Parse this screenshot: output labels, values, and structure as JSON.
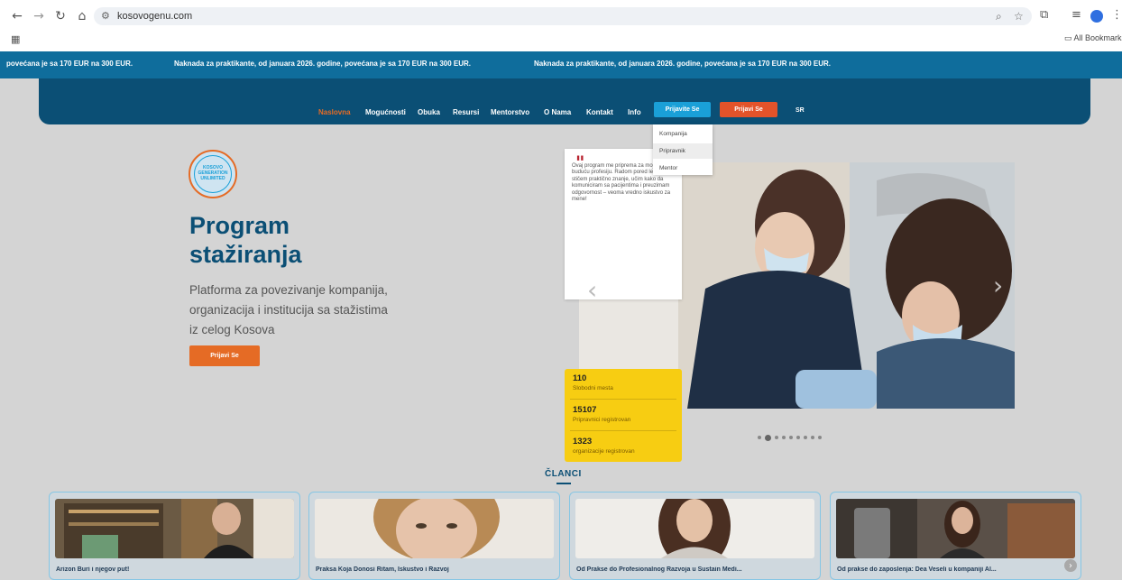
{
  "browser": {
    "url": "kosovogenu.com",
    "bookmarks_label": "All Bookmarks",
    "icons": [
      "back-icon",
      "forward-icon",
      "reload-icon",
      "home-icon",
      "site-info-icon",
      "zoom-icon",
      "star-icon",
      "extensions-icon",
      "media-icon",
      "profile-icon",
      "menu-icon",
      "apps-icon",
      "folder-icon"
    ]
  },
  "ticker": {
    "items": [
      "povećana je sa 170 EUR na 300 EUR.",
      "Naknada za praktikante, od januara 2026. godine, povećana je sa 170 EUR na 300 EUR.",
      "Naknada za praktikante, od januara 2026. godine, povećana je sa 170 EUR na 300 EUR."
    ]
  },
  "nav": {
    "links": [
      "Naslovna",
      "Mogućnosti",
      "Obuka",
      "Resursi",
      "Mentorstvo",
      "O Nama",
      "Kontakt",
      "Info"
    ],
    "active": "Naslovna",
    "prijavite_label": "Prijavite Se",
    "prijavi_label": "Prijavi Se",
    "lang": "SR",
    "dropdown": [
      "Kompanija",
      "Pripravnik",
      "Mentor"
    ]
  },
  "hero": {
    "logo_lines": [
      "KOSOVO",
      "GENERATION",
      "UNLIMITED"
    ],
    "title_line1": "Program",
    "title_line2": "stažiranja",
    "subtitle_line1": "Platforma za povezivanje kompanija,",
    "subtitle_line2": "organizacija i institucija sa stažistima",
    "subtitle_line3": "iz celog Kosova",
    "button": "Prijavi Se"
  },
  "carousel": {
    "quote": "Ovaj program me priprema za moju buduću profesiju. Radom pored lekara stičem praktično znanje, učim kako da komuniciram sa pacijentima i preuzimam odgovornost – veoma vredno iskustvo za mene!",
    "dots_total": 9,
    "dots_active": 1
  },
  "stats": [
    {
      "value": "110",
      "label": "Slobodni mesta"
    },
    {
      "value": "15107",
      "label": "Pripravnici registrovan"
    },
    {
      "value": "1323",
      "label": "organizacije registrovan"
    }
  ],
  "articles": {
    "section_title": "ČLANCI",
    "cards": [
      {
        "title": "Arizon Buri i njegov put!"
      },
      {
        "title": "Praksa Koja Donosi Ritam, Iskustvo i Razvoj"
      },
      {
        "title": "Od Prakse do Profesionalnog Razvoja u Sustain Medi..."
      },
      {
        "title": "Od prakse do zaposlenja: Dea Veseli u kompaniji Al..."
      }
    ]
  },
  "colors": {
    "ticker": "#0f6d9c",
    "navbar": "#0b4f75",
    "accent_orange": "#e56b25",
    "accent_blue": "#1aa0d8",
    "stats_yellow": "#f7cd12",
    "quote_red": "#b8232f"
  }
}
